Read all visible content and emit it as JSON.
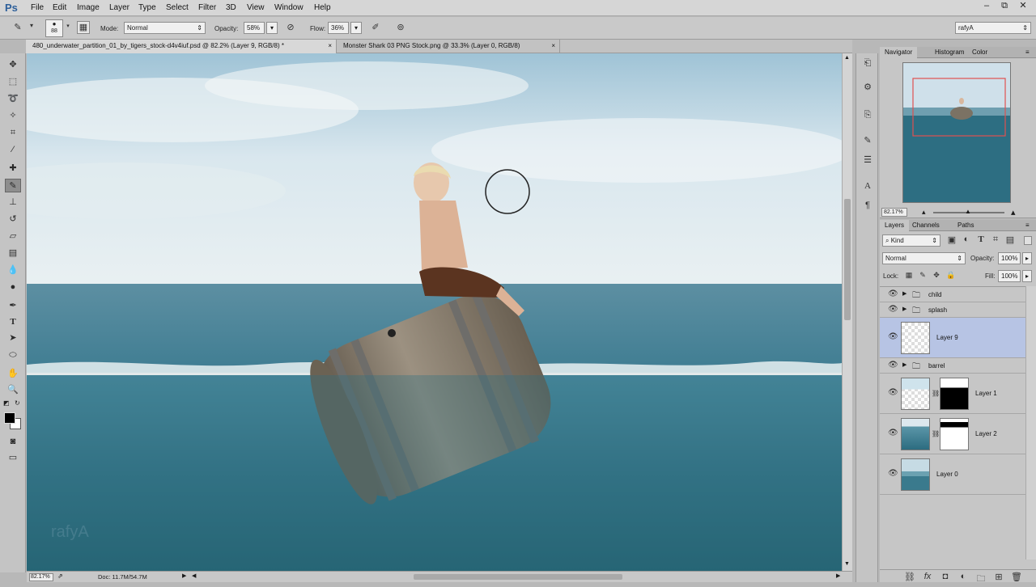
{
  "app": {
    "logo": "Ps"
  },
  "menubar": {
    "items": [
      "File",
      "Edit",
      "Image",
      "Layer",
      "Type",
      "Select",
      "Filter",
      "3D",
      "View",
      "Window",
      "Help"
    ],
    "window_buttons": [
      "–",
      "⧉",
      "✕"
    ]
  },
  "options": {
    "brush_size": "88",
    "mode_label": "Mode:",
    "mode_value": "Normal",
    "opacity_label": "Opacity:",
    "opacity_value": "58%",
    "flow_label": "Flow:",
    "flow_value": "36%",
    "workspace": "rafyA"
  },
  "tabs": [
    {
      "label": "480_underwater_partition_01_by_tigers_stock-d4v4iuf.psd @ 82.2% (Layer 9, RGB/8) *",
      "close": "×"
    },
    {
      "label": "Monster Shark 03 PNG Stock.png @ 33.3% (Layer 0, RGB/8)",
      "close": "×"
    }
  ],
  "status": {
    "zoom": "82.17%",
    "doc": "Doc: 11.7M/54.7M"
  },
  "canvas": {
    "watermark": "rafyA"
  },
  "navigator": {
    "tabs": [
      "Navigator",
      "Histogram",
      "Color"
    ],
    "zoom": "82.17%"
  },
  "layers_panel": {
    "tabs": [
      "Layers",
      "Channels",
      "Paths"
    ],
    "filter_kind": "Kind",
    "blend_mode": "Normal",
    "opacity_label": "Opacity:",
    "opacity_value": "100%",
    "lock_label": "Lock:",
    "fill_label": "Fill:",
    "fill_value": "100%",
    "layers": [
      {
        "name": "child",
        "type": "group"
      },
      {
        "name": "splash",
        "type": "group"
      },
      {
        "name": "Layer 9",
        "type": "layer",
        "selected": true
      },
      {
        "name": "barrel",
        "type": "group"
      },
      {
        "name": "Layer 1",
        "type": "layer-mask"
      },
      {
        "name": "Layer 2",
        "type": "layer-mask"
      },
      {
        "name": "Layer 0",
        "type": "layer"
      }
    ]
  },
  "colors": {
    "selected_layer": "#b7c4e4",
    "nav_box": "#e05050",
    "sea_dark": "#2c6678",
    "sky_light": "#e8eff3"
  }
}
